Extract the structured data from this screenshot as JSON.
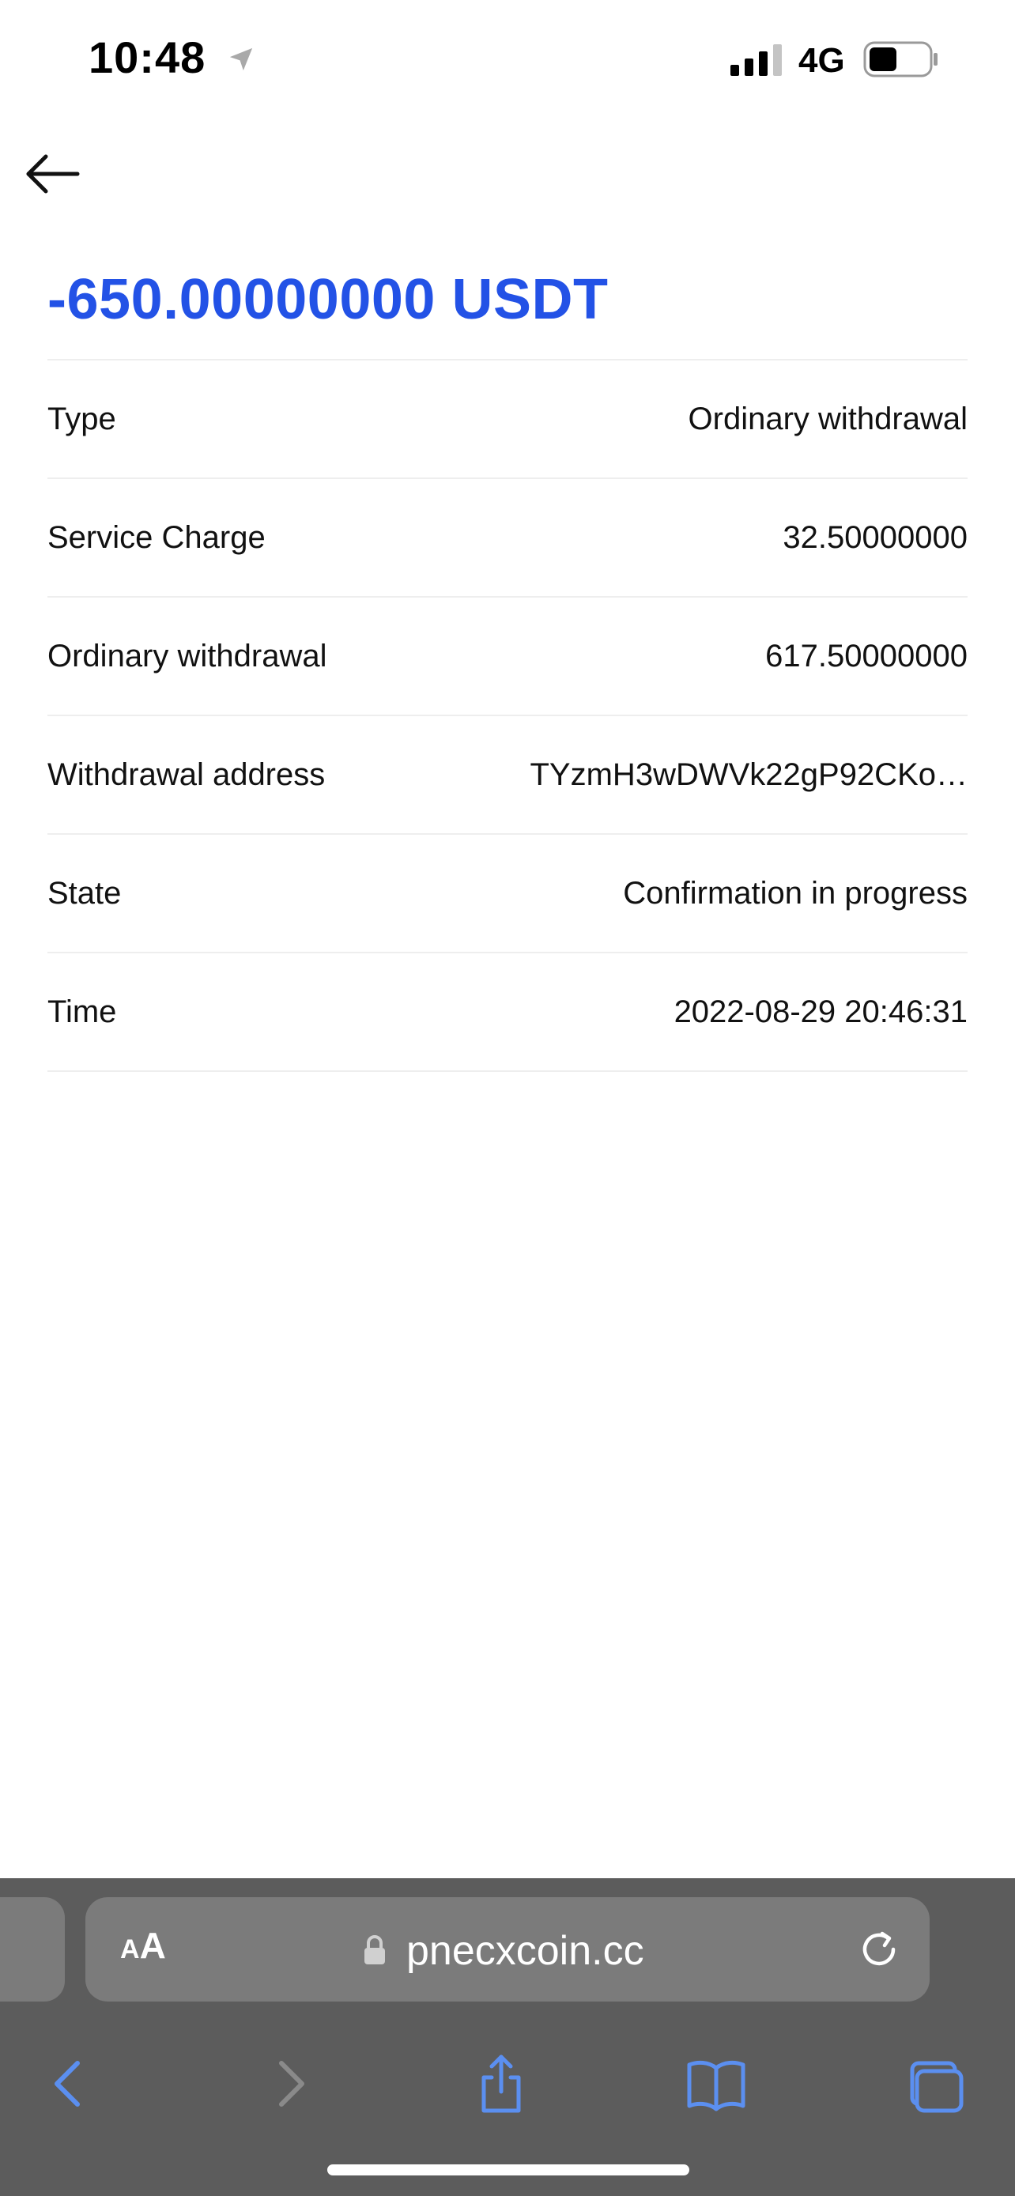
{
  "status_bar": {
    "time": "10:48",
    "network": "4G",
    "icons": [
      "location-arrow-icon",
      "signal-icon",
      "battery-icon"
    ]
  },
  "header": {
    "back_icon": "arrow-left-icon"
  },
  "transaction": {
    "amount": "-650.00000000 USDT",
    "amount_color": "#2352e6",
    "rows": [
      {
        "label": "Type",
        "value": "Ordinary withdrawal"
      },
      {
        "label": "Service Charge",
        "value": "32.50000000"
      },
      {
        "label": "Ordinary withdrawal",
        "value": "617.50000000"
      },
      {
        "label": "Withdrawal address",
        "value": "TYzmH3wDWVk22gP92CKo…"
      },
      {
        "label": "State",
        "value": "Confirmation in progress"
      },
      {
        "label": "Time",
        "value": "2022-08-29 20:46:31"
      }
    ]
  },
  "browser": {
    "aa_small": "A",
    "aa_big": "A",
    "url": "pnecxcoin.cc",
    "toolbar_color": "#5c5c5c",
    "accent_color": "#5b8ff0",
    "icons": [
      "lock-icon",
      "reload-icon",
      "chevron-left-icon",
      "chevron-right-icon",
      "share-icon",
      "book-icon",
      "tabs-icon"
    ]
  }
}
